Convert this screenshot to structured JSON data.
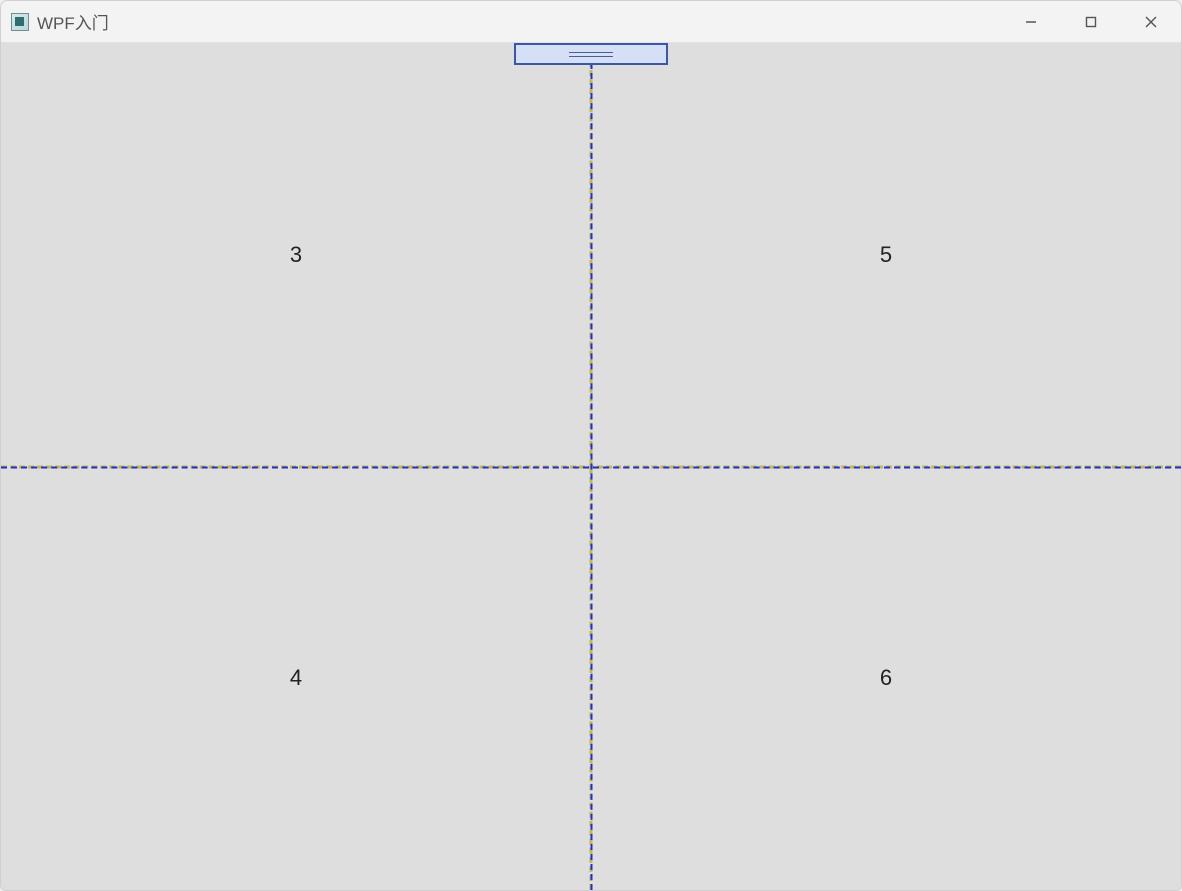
{
  "window": {
    "title": "WPF入门"
  },
  "grid": {
    "cells": {
      "top_left": "3",
      "top_right": "5",
      "bottom_left": "4",
      "bottom_right": "6"
    }
  },
  "colors": {
    "client_bg": "#dedede",
    "dash_primary": "#1a2edb",
    "dash_accent": "#c6b840",
    "thumb_fill": "#d5dff5",
    "thumb_border": "#3a57a8"
  }
}
